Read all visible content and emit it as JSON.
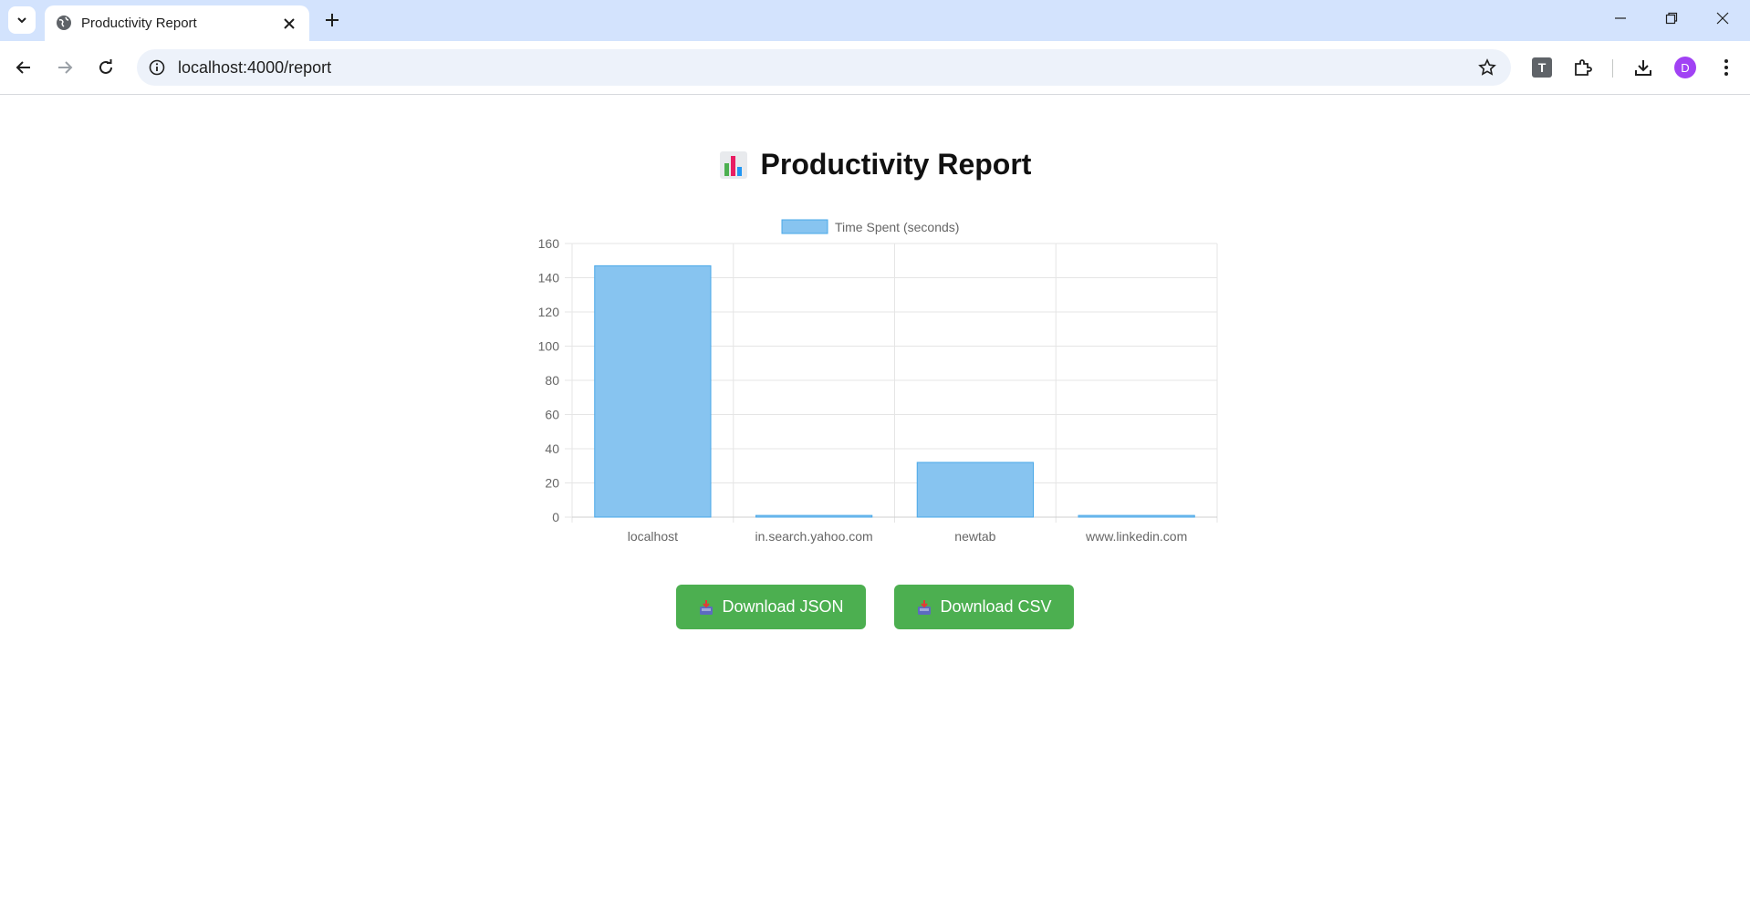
{
  "browser": {
    "tab_title": "Productivity Report",
    "url": "localhost:4000/report",
    "profile_initial": "D",
    "extension_label": "T"
  },
  "page": {
    "title": "Productivity Report",
    "title_icon": "bar-chart-icon"
  },
  "buttons": {
    "download_json": "Download JSON",
    "download_csv": "Download CSV",
    "icon": "inbox-tray-icon"
  },
  "colors": {
    "bar_fill": "#87c4f0",
    "bar_stroke": "#4aa8e8",
    "button_bg": "#4caf50"
  },
  "chart_data": {
    "type": "bar",
    "categories": [
      "localhost",
      "in.search.yahoo.com",
      "newtab",
      "www.linkedin.com"
    ],
    "series": [
      {
        "name": "Time Spent (seconds)",
        "values": [
          147,
          1,
          32,
          1
        ]
      }
    ],
    "ylim": [
      0,
      160
    ],
    "yticks": [
      0,
      20,
      40,
      60,
      80,
      100,
      120,
      140,
      160
    ],
    "grid": true,
    "legend": "top-center"
  }
}
